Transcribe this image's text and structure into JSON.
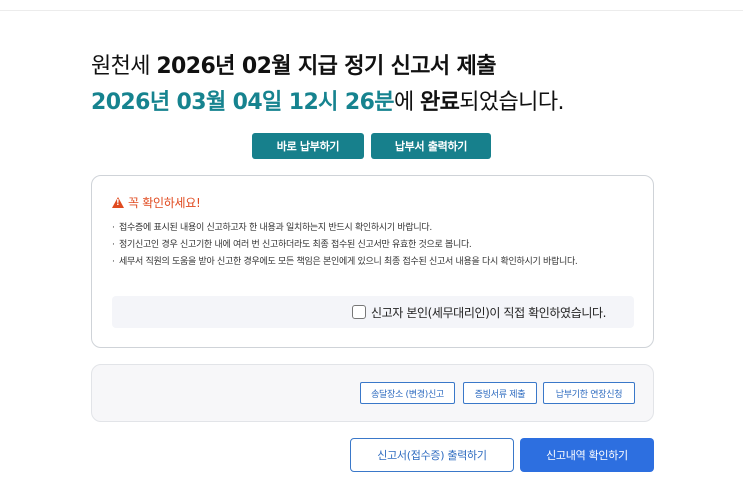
{
  "header": {
    "title_prefix": "원천세 ",
    "title_main": "2026년 02월 지급 정기 신고서 제출",
    "completion_datetime": "2026년 03월 04일 12시 26분",
    "completion_mid": "에 ",
    "completion_word": "완료",
    "completion_suffix": "되었습니다."
  },
  "actions": {
    "pay_now_label": "바로 납부하기",
    "print_payment_label": "납부서 출력하기"
  },
  "notice": {
    "title": "꼭 확인하세요!",
    "items": [
      "접수증에 표시된 내용이 신고하고자 한 내용과 일치하는지 반드시 확인하시기 바랍니다.",
      "정기신고인 경우 신고기한 내에 여러 번 신고하더라도 최종 접수된 신고서만 유효한 것으로 봅니다.",
      "세무서 직원의 도움을 받아 신고한 경우에도 모든 책임은 본인에게 있으니 최종 접수된 신고서 내용을 다시 확인하시기 바랍니다."
    ],
    "confirm_label": "신고자 본인(세무대리인)이 직접 확인하였습니다."
  },
  "links": {
    "address_change_label": "송달장소 (변경)신고",
    "evidence_submit_label": "증빙서류 제출",
    "extension_label": "납부기한 연장신청"
  },
  "footer": {
    "print_receipt_label": "신고서(접수증) 출력하기",
    "view_history_label": "신고내역 확인하기"
  },
  "colors": {
    "teal": "#17808c",
    "warning": "#e04a1f",
    "primary": "#2d6fe0"
  }
}
